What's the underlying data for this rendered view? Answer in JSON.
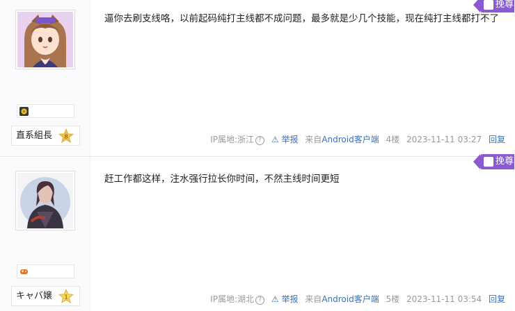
{
  "posts": [
    {
      "avatar": "anime-girl-avatar",
      "badge_icon": "flower-badge-icon",
      "rank_label": "直系組長",
      "rank_level": "8",
      "content": "逼你去刷支线咯，以前起码纯打主线都不成问题，最多就是少几个技能，现在纯打主线都打不了",
      "gift": "挽尊",
      "ip": "IP属地:浙江",
      "report": "举报",
      "device_prefix": "来自",
      "device": "Android客户端",
      "floor": "4楼",
      "time": "2023-11-11 03:27",
      "reply": "回复"
    },
    {
      "avatar": "dark-figure-avatar",
      "badge_icon": "gamepad-badge-icon",
      "rank_label": "キャバ嬢",
      "rank_level": "1",
      "content": "赶工作都这样，注水强行拉长你时间，不然主线时间更短",
      "gift": "挽尊",
      "ip": "IP属地:湖北",
      "report": "举报",
      "device_prefix": "来自",
      "device": "Android客户端",
      "floor": "5楼",
      "time": "2023-11-11 03:54",
      "reply": "回复"
    }
  ],
  "colors": {
    "gift": "#8a5ad0",
    "link": "#3a6fb8",
    "meta": "#999999",
    "star": "#f0c24a"
  }
}
